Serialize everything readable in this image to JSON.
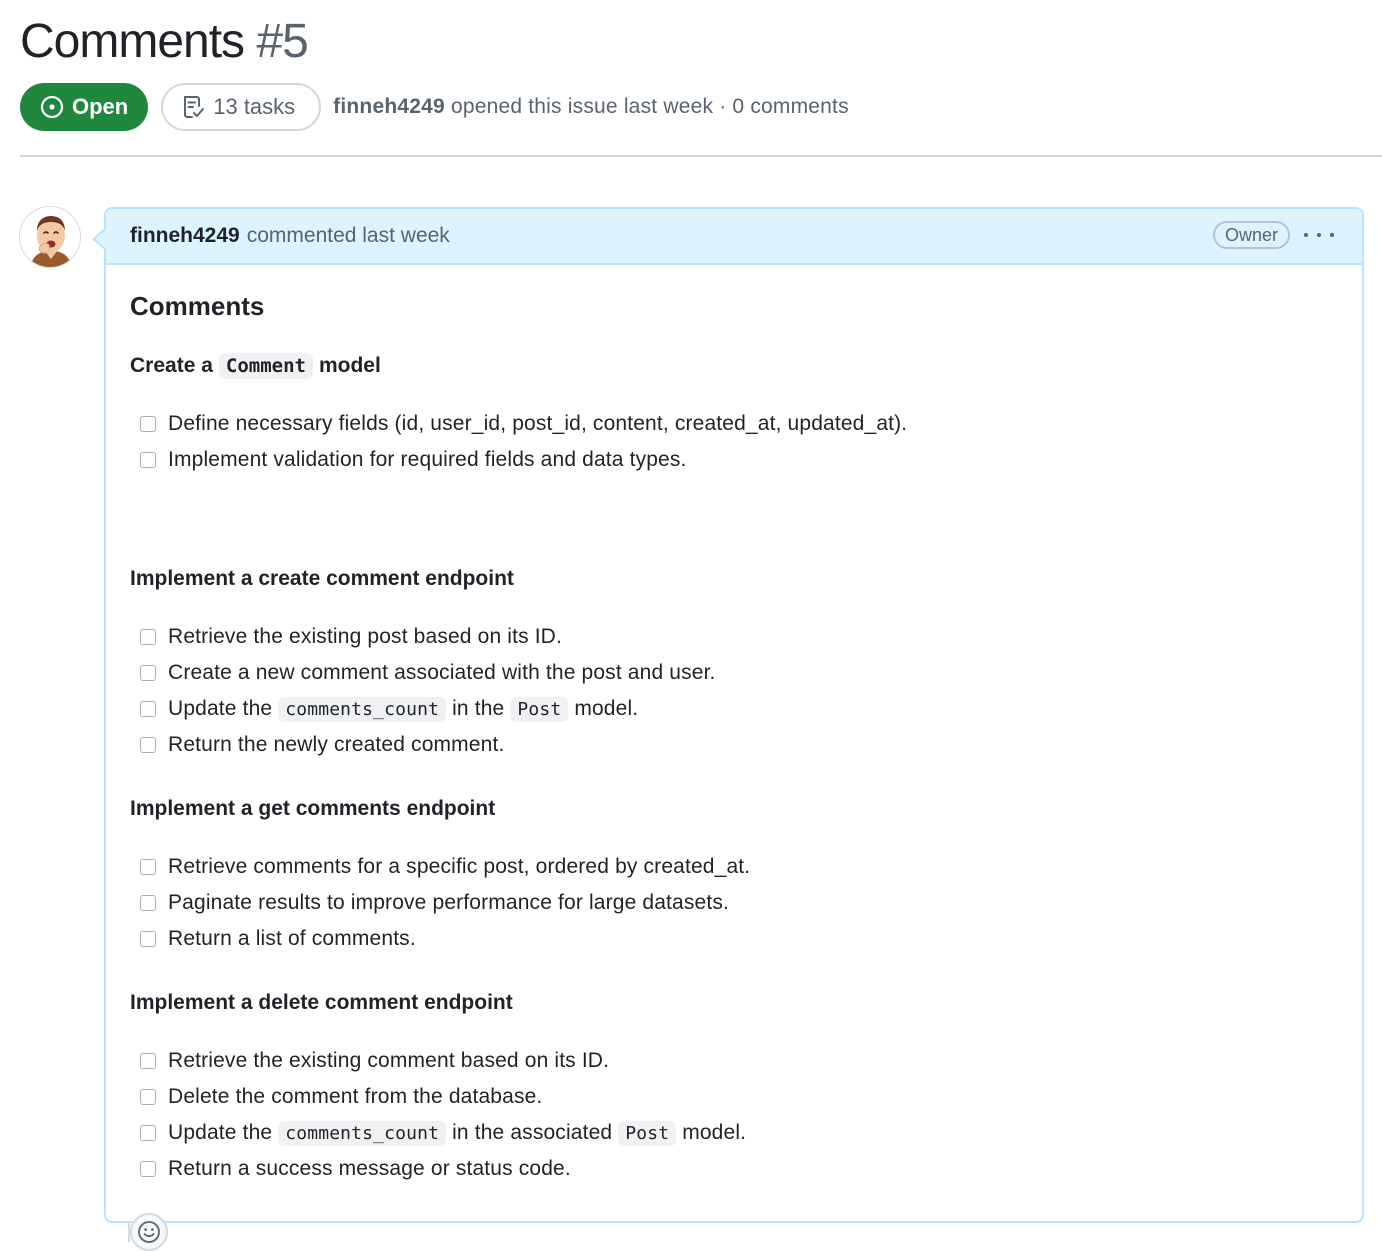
{
  "issue": {
    "title": "Comments",
    "number": "#5",
    "state_label": "Open",
    "tasks_label": "13 tasks",
    "author": "finneh4249",
    "opened_text": "opened this issue last week · 0 comments"
  },
  "comment": {
    "author": "finneh4249",
    "time": "commented last week",
    "role_badge": "Owner",
    "body_title": "Comments",
    "sections": [
      {
        "heading_prefix": "Create a",
        "heading_code": "Comment",
        "heading_suffix": "model",
        "items": [
          {
            "text": "Define necessary fields (id, user_id, post_id, content, created_at, updated_at)."
          },
          {
            "text": "Implement validation for required fields and data types."
          }
        ]
      },
      {
        "heading": "Implement a create comment endpoint",
        "items": [
          {
            "text": "Retrieve the existing post based on its ID."
          },
          {
            "text": "Create a new comment associated with the post and user."
          },
          {
            "pre": "Update the",
            "code1": "comments_count",
            "mid": "in the",
            "code2": "Post",
            "post": "model."
          },
          {
            "text": "Return the newly created comment."
          }
        ]
      },
      {
        "heading": "Implement a get comments endpoint",
        "items": [
          {
            "text": "Retrieve comments for a specific post, ordered by created_at."
          },
          {
            "text": "Paginate results to improve performance for large datasets."
          },
          {
            "text": "Return a list of comments."
          }
        ]
      },
      {
        "heading": "Implement a delete comment endpoint",
        "items": [
          {
            "text": "Retrieve the existing comment based on its ID."
          },
          {
            "text": "Delete the comment from the database."
          },
          {
            "pre": "Update the",
            "code1": "comments_count",
            "mid": "in the associated",
            "code2": "Post",
            "post": "model."
          },
          {
            "text": "Return a success message or status code."
          }
        ]
      }
    ]
  },
  "icons": {
    "state": "issue-opened-icon",
    "tasks": "checklist-icon",
    "more": "kebab-horizontal-icon",
    "reaction": "smiley-icon"
  },
  "colors": {
    "open_green": "#1f883d",
    "header_blue": "#ddf4ff",
    "border_blue": "#b6e3ff",
    "muted_text": "#59636e"
  }
}
